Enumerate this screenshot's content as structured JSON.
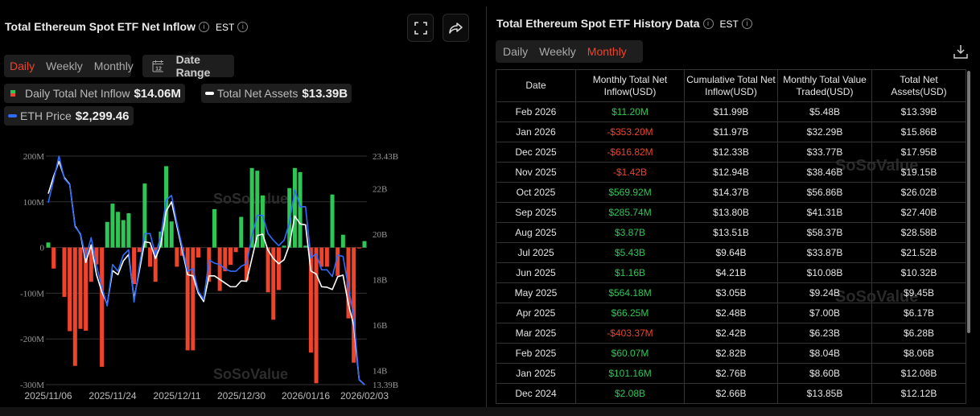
{
  "left": {
    "title": "Total Ethereum Spot ETF Net Inflow",
    "tz": "EST",
    "tabs": [
      "Daily",
      "Weekly",
      "Monthly"
    ],
    "active_tab": "Daily",
    "date_range": "Date Range",
    "calendar_day": "12",
    "legend": [
      {
        "label": "Daily Total Net Inflow",
        "value": "$14.06M"
      },
      {
        "label": "Total Net Assets",
        "value": "$13.39B"
      },
      {
        "label": "ETH Price",
        "value": "$2,299.46"
      }
    ],
    "watermark": "SoSoValue"
  },
  "chart_data": {
    "type": "bar",
    "x_ticks": [
      "2025/11/06",
      "2025/11/24",
      "2025/12/11",
      "2025/12/30",
      "2026/01/16",
      "2026/02/03"
    ],
    "y_left_ticks": [
      "200M",
      "100M",
      "0",
      "-100M",
      "-200M",
      "-300M"
    ],
    "y_right_ticks": [
      "23.43B",
      "22B",
      "20B",
      "18B",
      "16B",
      "14B",
      "13.39B"
    ],
    "ylim_left_musd": [
      -300,
      200
    ],
    "ylim_right_busd": [
      13.39,
      23.43
    ],
    "grid": true,
    "colors": {
      "inflow_pos": "#2ec755",
      "inflow_neg": "#f0432b",
      "net_assets": "#ffffff",
      "eth_price": "#2f6bff"
    },
    "series": [
      {
        "name": "Daily Total Net Inflow",
        "type": "bar",
        "unit": "M USD",
        "values": [
          11,
          -46,
          0,
          -108,
          -183,
          -259,
          -178,
          -182,
          -75,
          -37,
          -261,
          56,
          96,
          78,
          60,
          75,
          -80,
          -10,
          140,
          -42,
          -75,
          35,
          178,
          57,
          -42,
          -18,
          -225,
          -225,
          -22,
          0,
          -75,
          84,
          -95,
          -52,
          -38,
          -10,
          67,
          -72,
          174,
          168,
          114,
          -98,
          -158,
          -93,
          4,
          130,
          174,
          165,
          4,
          -230,
          -297,
          -42,
          -42,
          116,
          -62,
          28,
          -155,
          -252,
          -2,
          14.06
        ]
      },
      {
        "name": "Total Net Assets",
        "type": "line",
        "unit": "B USD",
        "values": [
          21.78,
          22.54,
          23.2,
          22.49,
          22.19,
          20.36,
          20.0,
          18.76,
          19.53,
          18.22,
          17.46,
          16.92,
          18.4,
          18.22,
          18.82,
          19.11,
          17.16,
          18.4,
          19.67,
          19.62,
          18.93,
          19.53,
          21.01,
          21.42,
          20.36,
          19.29,
          18.22,
          18.17,
          17.4,
          17.04,
          18.17,
          18.17,
          18.01,
          17.85,
          17.69,
          17.69,
          17.95,
          17.93,
          18.93,
          19.94,
          20.0,
          19.29,
          18.93,
          18.7,
          18.88,
          19.53,
          20.8,
          20.45,
          20.41,
          18.38,
          18.25,
          17.69,
          17.67,
          17.57,
          18.13,
          18.2,
          16.92,
          15.98,
          13.61,
          13.39
        ]
      },
      {
        "name": "ETH Price",
        "type": "line",
        "unit": "USD",
        "values": [
          3335,
          3465,
          3600,
          3472,
          3437,
          3197,
          3159,
          3022,
          3136,
          2976,
          2854,
          2747,
          2983,
          2945,
          3037,
          3067,
          2769,
          2976,
          3159,
          3159,
          3037,
          3144,
          3350,
          3376,
          3220,
          3083,
          2945,
          2960,
          2831,
          2785,
          3009,
          2991,
          2983,
          2957,
          2945,
          2945,
          2973,
          2988,
          3144,
          3263,
          3262,
          3159,
          3121,
          3090,
          3121,
          3220,
          3407,
          3312,
          3312,
          3022,
          3044,
          2953,
          2953,
          2915,
          3037,
          3029,
          2854,
          2685,
          2326,
          2299.46
        ]
      }
    ]
  },
  "right": {
    "title": "Total Ethereum Spot ETF History Data",
    "tz": "EST",
    "tabs": [
      "Daily",
      "Weekly",
      "Monthly"
    ],
    "active_tab": "Monthly",
    "columns": [
      "Date",
      "Monthly Total Net Inflow(USD)",
      "Cumulative Total Net Inflow(USD)",
      "Monthly Total Value Traded(USD)",
      "Total Net Assets(USD)"
    ],
    "rows": [
      [
        "Feb 2026",
        "$11.20M",
        "$11.99B",
        "$5.48B",
        "$13.39B"
      ],
      [
        "Jan 2026",
        "-$353.20M",
        "$11.97B",
        "$32.29B",
        "$15.86B"
      ],
      [
        "Dec 2025",
        "-$616.82M",
        "$12.33B",
        "$33.77B",
        "$17.95B"
      ],
      [
        "Nov 2025",
        "-$1.42B",
        "$12.94B",
        "$38.46B",
        "$19.15B"
      ],
      [
        "Oct 2025",
        "$569.92M",
        "$14.37B",
        "$56.86B",
        "$26.02B"
      ],
      [
        "Sep 2025",
        "$285.74M",
        "$13.80B",
        "$41.31B",
        "$27.40B"
      ],
      [
        "Aug 2025",
        "$3.87B",
        "$13.51B",
        "$58.37B",
        "$28.58B"
      ],
      [
        "Jul 2025",
        "$5.43B",
        "$9.64B",
        "$33.87B",
        "$21.52B"
      ],
      [
        "Jun 2025",
        "$1.16B",
        "$4.21B",
        "$10.08B",
        "$10.32B"
      ],
      [
        "May 2025",
        "$564.18M",
        "$3.05B",
        "$9.24B",
        "$9.45B"
      ],
      [
        "Apr 2025",
        "$66.25M",
        "$2.48B",
        "$7.00B",
        "$6.17B"
      ],
      [
        "Mar 2025",
        "-$403.37M",
        "$2.42B",
        "$6.23B",
        "$6.28B"
      ],
      [
        "Feb 2025",
        "$60.07M",
        "$2.82B",
        "$8.04B",
        "$8.06B"
      ],
      [
        "Jan 2025",
        "$101.16M",
        "$2.76B",
        "$8.60B",
        "$12.08B"
      ],
      [
        "Dec 2024",
        "$2.08B",
        "$2.66B",
        "$13.85B",
        "$12.12B"
      ]
    ],
    "watermark": "SoSoValue"
  }
}
